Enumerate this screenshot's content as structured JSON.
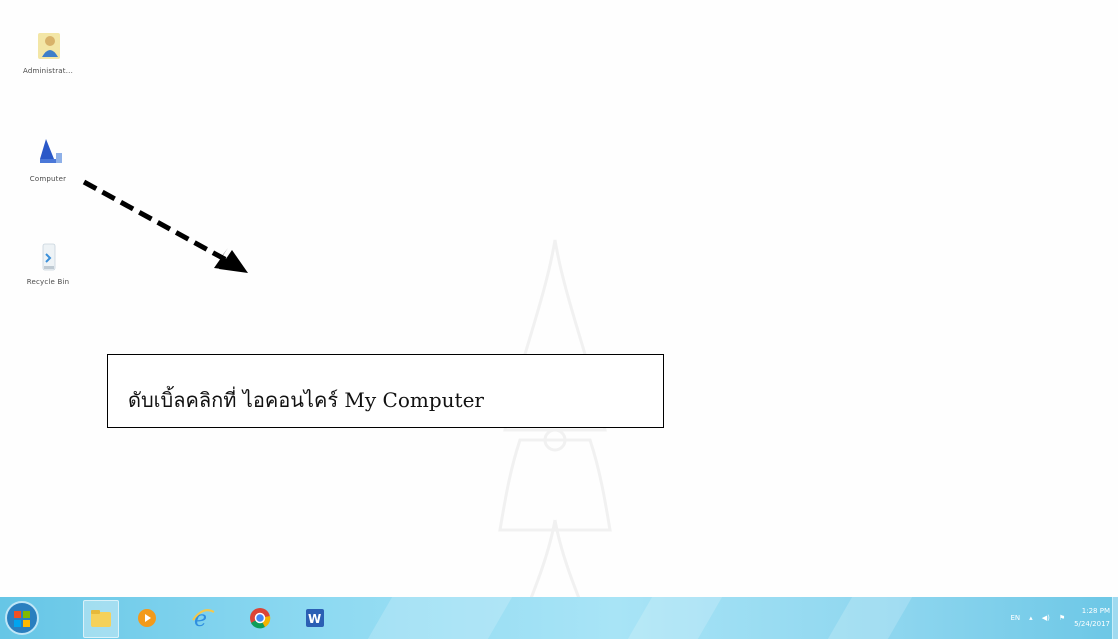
{
  "desktop": {
    "icons": [
      {
        "label": "Administrat..."
      },
      {
        "label": "Computer"
      },
      {
        "label": "Recycle Bin"
      }
    ]
  },
  "callout": {
    "text": "ดับเบิ้ลคลิกที่ ไอคอนไคร์ My Computer"
  },
  "taskbar": {
    "pinned": [
      "explorer-icon",
      "media-player-icon",
      "internet-explorer-icon",
      "chrome-icon",
      "word-icon"
    ],
    "tray": {
      "language": "EN",
      "time": "1:28 PM",
      "date": "5/24/2017"
    }
  },
  "colors": {
    "taskbar": "#8fdaf2",
    "arrow": "#000000"
  }
}
